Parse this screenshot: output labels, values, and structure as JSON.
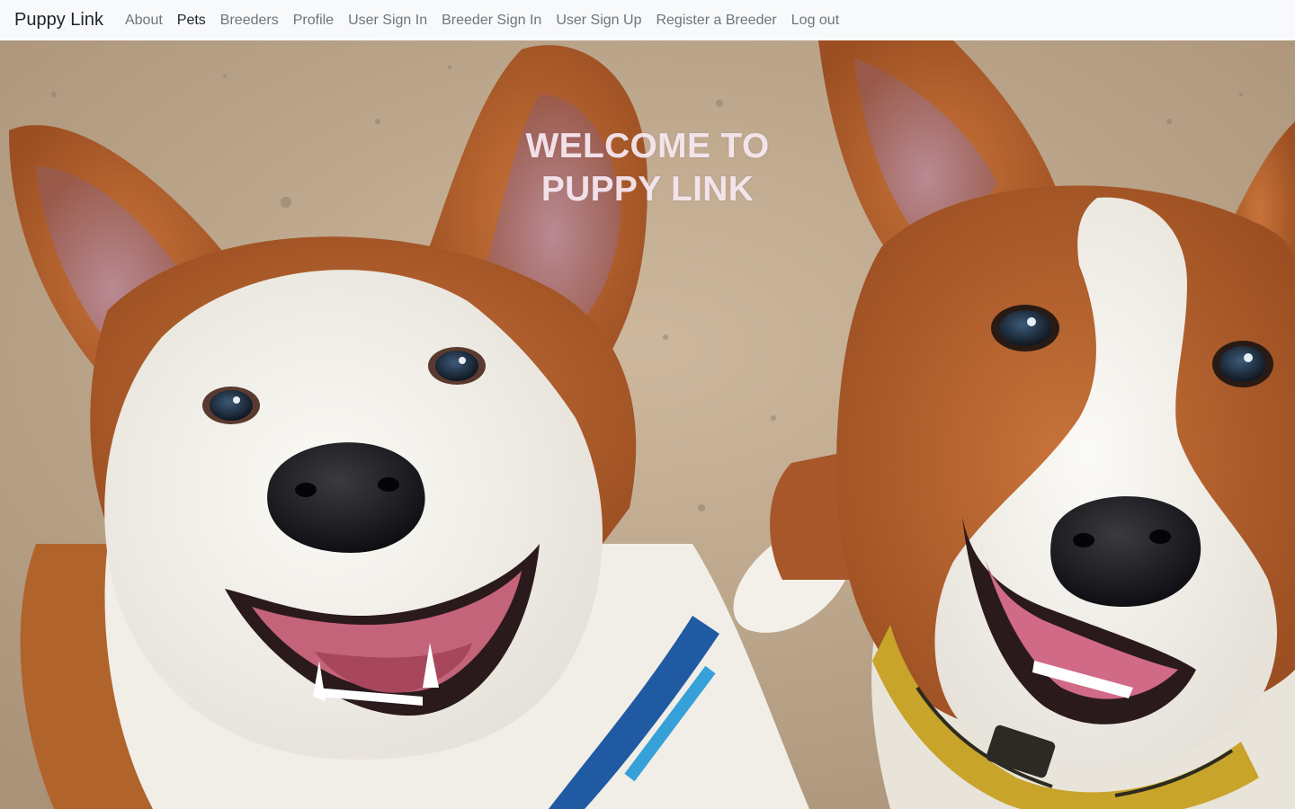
{
  "navbar": {
    "brand": "Puppy Link",
    "links": [
      {
        "label": "About",
        "active": false
      },
      {
        "label": "Pets",
        "active": true
      },
      {
        "label": "Breeders",
        "active": false
      },
      {
        "label": "Profile",
        "active": false
      },
      {
        "label": "User Sign In",
        "active": false
      },
      {
        "label": "Breeder Sign In",
        "active": false
      },
      {
        "label": "User Sign Up",
        "active": false
      },
      {
        "label": "Register a Breeder",
        "active": false
      },
      {
        "label": "Log out",
        "active": false
      }
    ]
  },
  "hero": {
    "title_line1": "WELCOME TO",
    "title_line2": "PUPPY LINK",
    "image": "two-corgis-photo",
    "colors": {
      "ground": "#c4ae94",
      "fur_orange": "#b9632a",
      "fur_white": "#f7f5ef",
      "title": "#f8eaf2"
    }
  }
}
